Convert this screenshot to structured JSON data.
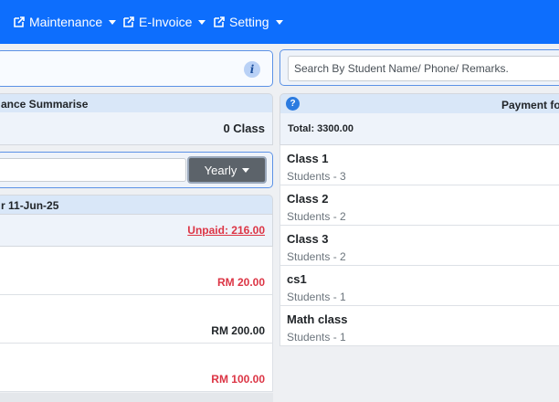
{
  "nav": {
    "items": [
      {
        "label": "Maintenance",
        "icon": "external-edit-icon"
      },
      {
        "label": "E-Invoice",
        "icon": "external-edit-icon"
      },
      {
        "label": "Setting",
        "icon": "external-edit-icon"
      }
    ]
  },
  "left": {
    "summary_title": "ance Summarise",
    "class_count": "0 Class",
    "period_button": "Yearly",
    "range_title": "r 11-Jun-25",
    "unpaid": "Unpaid: 216.00",
    "amounts": [
      "RM 20.00",
      "RM 200.00",
      "RM 100.00"
    ]
  },
  "right": {
    "search_placeholder": "Search By Student Name/ Phone/ Remarks.",
    "payment_title": "Payment fo",
    "total": "Total: 3300.00",
    "classes": [
      {
        "name": "Class 1",
        "students": "Students - 3"
      },
      {
        "name": "Class 2",
        "students": "Students - 2"
      },
      {
        "name": "Class 3",
        "students": "Students - 2"
      },
      {
        "name": "cs1",
        "students": "Students - 1"
      },
      {
        "name": "Math class",
        "students": "Students - 1"
      }
    ]
  },
  "colors": {
    "navbar": "#0d6efd",
    "accent_border": "#5c92e6",
    "unpaid_red": "#dc3545",
    "button_gray": "#5c636a"
  }
}
